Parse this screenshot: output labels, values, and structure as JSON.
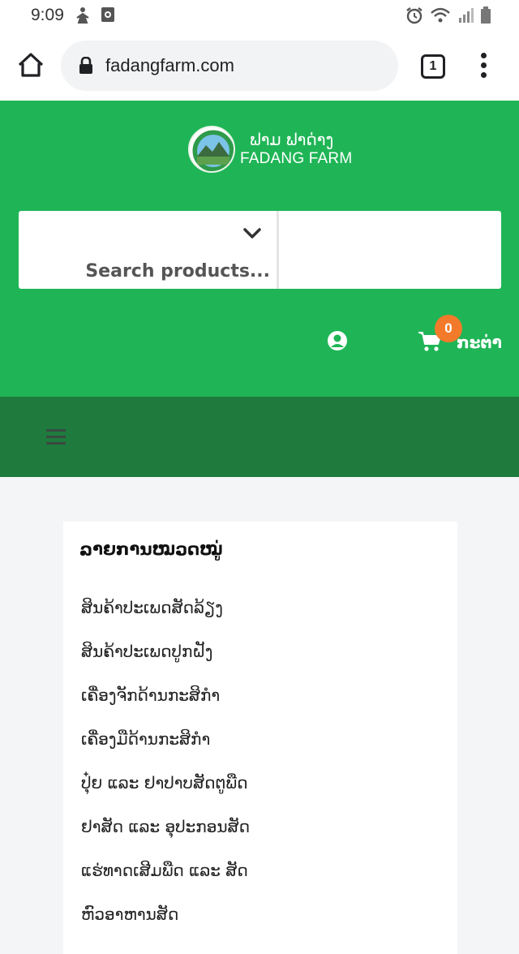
{
  "status_bar": {
    "time": "9:09"
  },
  "browser": {
    "url": "fadangfarm.com",
    "tab_count": "1"
  },
  "header": {
    "logo_lao": "ຟາມ ຟາດ່າງ",
    "logo_en": "FADANG FARM",
    "search_placeholder": "Search products...",
    "cart_count": "0",
    "cart_label": "ກະຕ່າ",
    "colors": {
      "header_green": "#1fb556",
      "nav_green": "#1e7b3d",
      "badge_orange": "#f27a2a"
    }
  },
  "categories": {
    "title": "ລາຍການໝວດໝູ່",
    "items": [
      "ສິນຄ້າປະເພດສັດລ້ຽງ",
      "ສິນຄ້າປະເພດປູກຝັງ",
      "ເຄື່ອງຈັກດ້ານກະສິກຳ",
      "ເຄື່ອງມືດ້ານກະສິກຳ",
      "ປຸ໋ຍ ແລະ ຢາປາບສັດຕູພືດ",
      "ຢາສັດ ແລະ ອຸປະກອນສັດ",
      "ແຮ່ທາດເສີມພືດ ແລະ ສັດ",
      "ຫົວອາຫານສັດ"
    ]
  },
  "icons": [
    "person-walking-icon",
    "media-icon",
    "alarm-icon",
    "wifi-icon",
    "signal-icon",
    "battery-icon",
    "home-icon",
    "lock-icon",
    "menu-dots-icon",
    "chevron-down-icon",
    "account-icon",
    "cart-icon",
    "hamburger-icon"
  ]
}
